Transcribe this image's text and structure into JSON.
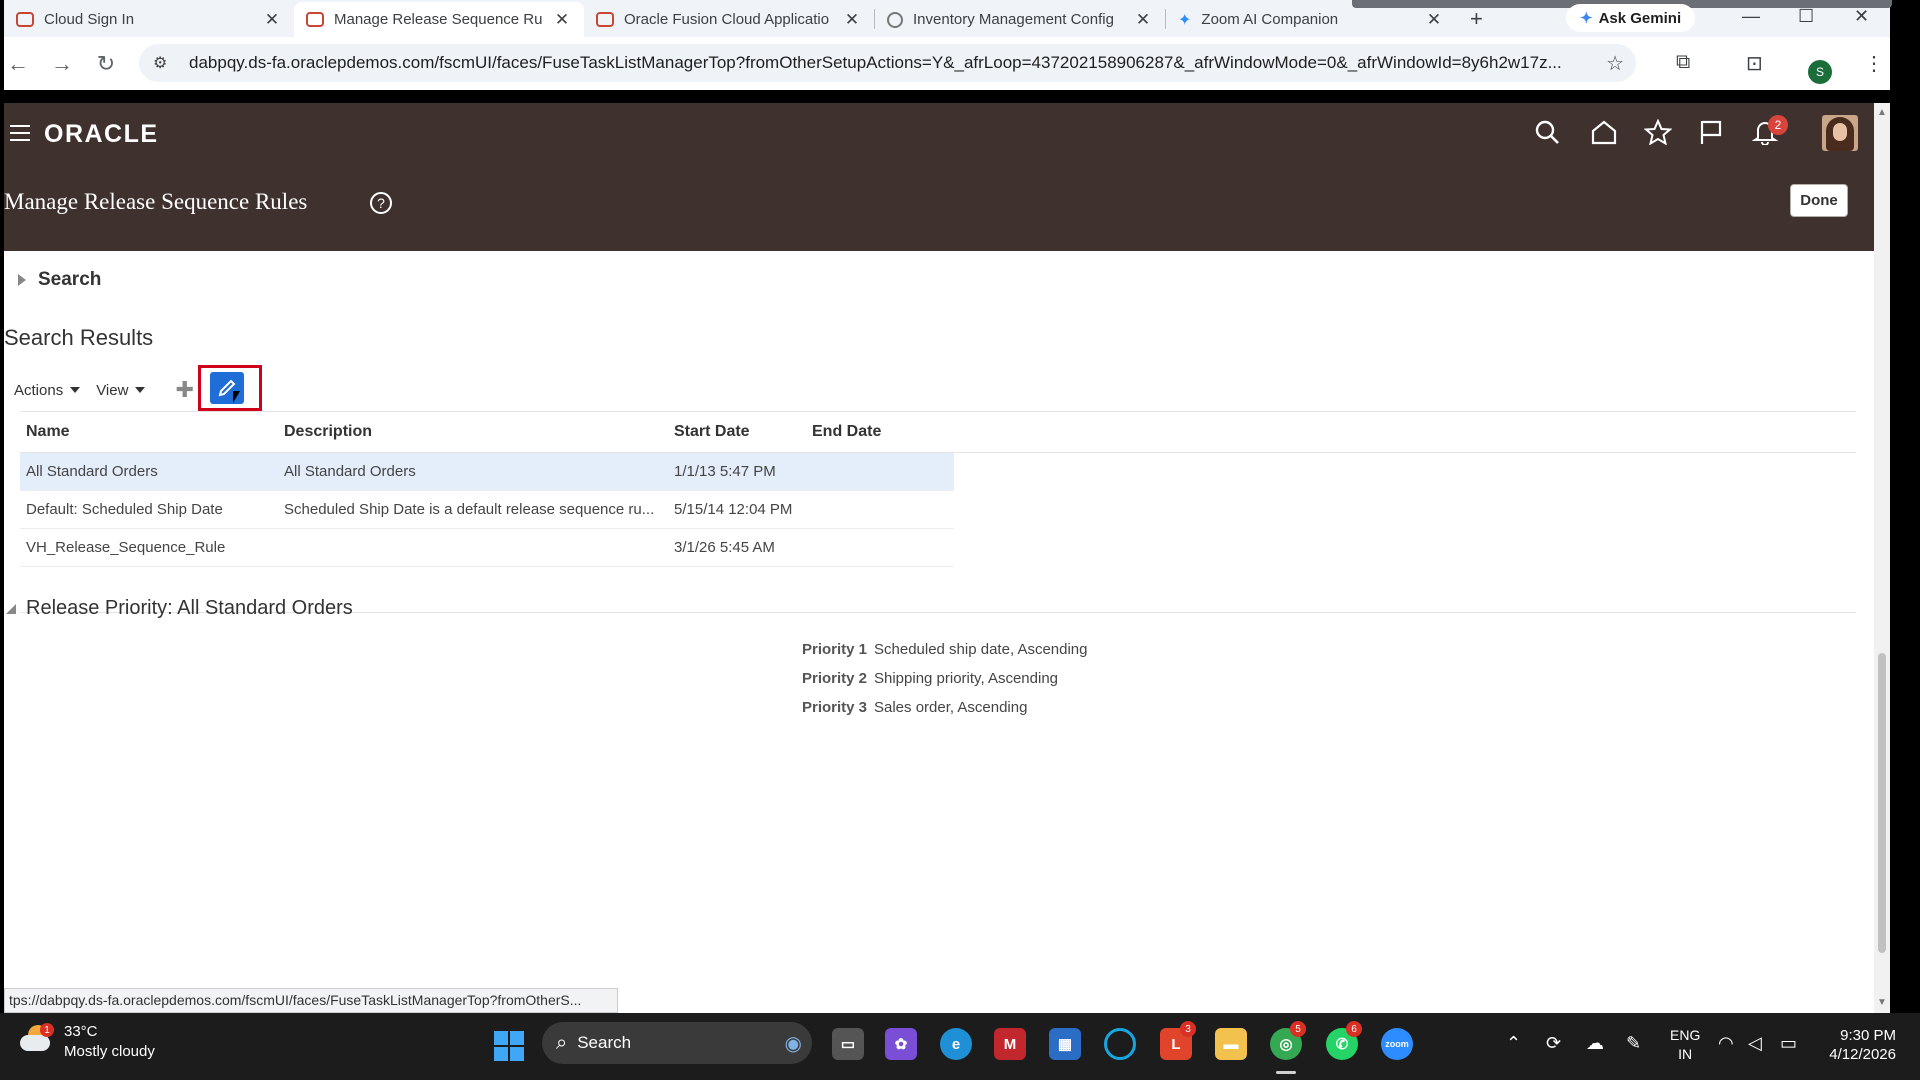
{
  "browser": {
    "tabs": [
      {
        "title": "Cloud Sign In",
        "icon": "oracle-favicon",
        "active": false
      },
      {
        "title": "Manage Release Sequence Ru",
        "icon": "oracle-favicon",
        "active": true
      },
      {
        "title": "Oracle Fusion Cloud Applicatio",
        "icon": "oracle-favicon",
        "active": false
      },
      {
        "title": "Inventory Management Config",
        "icon": "globe-favicon",
        "active": false
      },
      {
        "title": "Zoom AI Companion",
        "icon": "zoom-favicon",
        "active": false
      }
    ],
    "ask_gemini": "Ask Gemini",
    "url": "dabpqy.ds-fa.oraclepdemos.com/fscmUI/faces/FuseTaskListManagerTop?fromOtherSetupActions=Y&_afrLoop=437202158906287&_afrWindowMode=0&_afrWindowId=8y6h2w17z...",
    "profile_initial": "S"
  },
  "header": {
    "logo": "ORACLE",
    "notification_count": "2",
    "page_title": "Manage Release Sequence Rules",
    "help": "?",
    "done_label": "Done"
  },
  "search": {
    "label": "Search"
  },
  "results": {
    "title": "Search Results",
    "actions_label": "Actions",
    "view_label": "View",
    "columns": [
      "Name",
      "Description",
      "Start Date",
      "End Date"
    ],
    "rows": [
      {
        "name": "All Standard Orders",
        "description": "All Standard Orders",
        "start": "1/1/13 5:47 PM",
        "end": "",
        "selected": true
      },
      {
        "name": "Default: Scheduled Ship Date",
        "description": "Scheduled Ship Date is a default release sequence ru...",
        "start": "5/15/14 12:04 PM",
        "end": "",
        "selected": false
      },
      {
        "name": "VH_Release_Sequence_Rule",
        "description": "",
        "start": "3/1/26 5:45 AM",
        "end": "",
        "selected": false
      }
    ]
  },
  "release_priority": {
    "title": "Release Priority: All Standard Orders",
    "priorities": [
      {
        "label": "Priority 1",
        "value": "Scheduled ship date, Ascending"
      },
      {
        "label": "Priority 2",
        "value": "Shipping priority, Ascending"
      },
      {
        "label": "Priority 3",
        "value": "Sales order, Ascending"
      }
    ]
  },
  "status_url": "tps://dabpqy.ds-fa.oraclepdemos.com/fscmUI/faces/FuseTaskListManagerTop?fromOtherS...",
  "taskbar": {
    "temperature": "33°C",
    "weather": "Mostly cloudy",
    "weather_badge": "1",
    "search_label": "Search",
    "badge_l": "3",
    "badge_chrome": "5",
    "badge_whatsapp": "6",
    "zoom_label": "zoom",
    "lang_top": "ENG",
    "lang_bottom": "IN",
    "time": "9:30 PM",
    "date": "4/12/2026"
  }
}
